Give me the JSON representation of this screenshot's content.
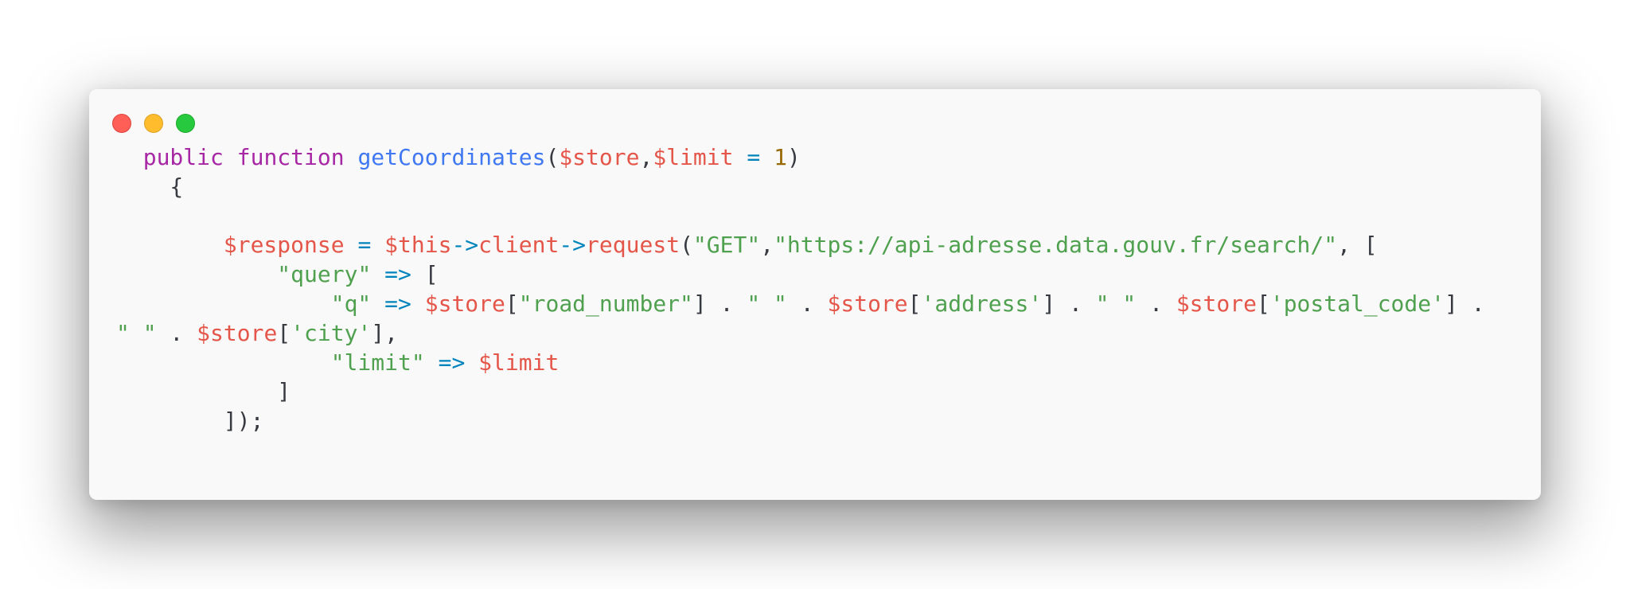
{
  "window": {
    "controls": {
      "close_color": "#ff5f56",
      "minimize_color": "#ffbd2e",
      "maximize_color": "#27c93f"
    }
  },
  "colors": {
    "background": "#f9f9f9",
    "keyword": "#a626a4",
    "function": "#4078f2",
    "variable": "#e45649",
    "operator": "#0184bc",
    "number": "#986801",
    "string": "#50a14f",
    "plain": "#383a42"
  },
  "code": {
    "lines": [
      [
        {
          "t": "  ",
          "c": "pl"
        },
        {
          "t": "public",
          "c": "kw"
        },
        {
          "t": " ",
          "c": "pl"
        },
        {
          "t": "function",
          "c": "kw"
        },
        {
          "t": " ",
          "c": "pl"
        },
        {
          "t": "getCoordinates",
          "c": "fn"
        },
        {
          "t": "(",
          "c": "pl"
        },
        {
          "t": "$store",
          "c": "var"
        },
        {
          "t": ",",
          "c": "pl"
        },
        {
          "t": "$limit",
          "c": "var"
        },
        {
          "t": " ",
          "c": "pl"
        },
        {
          "t": "=",
          "c": "op"
        },
        {
          "t": " ",
          "c": "pl"
        },
        {
          "t": "1",
          "c": "num"
        },
        {
          "t": ")",
          "c": "pl"
        }
      ],
      [
        {
          "t": "    {",
          "c": "pl"
        }
      ],
      [],
      [
        {
          "t": "        ",
          "c": "pl"
        },
        {
          "t": "$response",
          "c": "var"
        },
        {
          "t": " ",
          "c": "pl"
        },
        {
          "t": "=",
          "c": "op"
        },
        {
          "t": " ",
          "c": "pl"
        },
        {
          "t": "$this",
          "c": "var"
        },
        {
          "t": "->",
          "c": "op"
        },
        {
          "t": "client",
          "c": "prop"
        },
        {
          "t": "->",
          "c": "op"
        },
        {
          "t": "request",
          "c": "prop"
        },
        {
          "t": "(",
          "c": "pl"
        },
        {
          "t": "\"GET\"",
          "c": "str"
        },
        {
          "t": ",",
          "c": "pl"
        },
        {
          "t": "\"https://api-adresse.data.gouv.fr/search/\"",
          "c": "str"
        },
        {
          "t": ", [",
          "c": "pl"
        }
      ],
      [
        {
          "t": "            ",
          "c": "pl"
        },
        {
          "t": "\"query\"",
          "c": "str"
        },
        {
          "t": " ",
          "c": "pl"
        },
        {
          "t": "=>",
          "c": "op"
        },
        {
          "t": " [",
          "c": "pl"
        }
      ],
      [
        {
          "t": "                ",
          "c": "pl"
        },
        {
          "t": "\"q\"",
          "c": "str"
        },
        {
          "t": " ",
          "c": "pl"
        },
        {
          "t": "=>",
          "c": "op"
        },
        {
          "t": " ",
          "c": "pl"
        },
        {
          "t": "$store",
          "c": "var"
        },
        {
          "t": "[",
          "c": "pl"
        },
        {
          "t": "\"road_number\"",
          "c": "str"
        },
        {
          "t": "] . ",
          "c": "pl"
        },
        {
          "t": "\" \"",
          "c": "str"
        },
        {
          "t": " . ",
          "c": "pl"
        },
        {
          "t": "$store",
          "c": "var"
        },
        {
          "t": "[",
          "c": "pl"
        },
        {
          "t": "'address'",
          "c": "str"
        },
        {
          "t": "] . ",
          "c": "pl"
        },
        {
          "t": "\" \"",
          "c": "str"
        },
        {
          "t": " . ",
          "c": "pl"
        },
        {
          "t": "$store",
          "c": "var"
        },
        {
          "t": "[",
          "c": "pl"
        },
        {
          "t": "'postal_code'",
          "c": "str"
        },
        {
          "t": "] .",
          "c": "pl"
        }
      ],
      [
        {
          "t": "\" \"",
          "c": "str"
        },
        {
          "t": " . ",
          "c": "pl"
        },
        {
          "t": "$store",
          "c": "var"
        },
        {
          "t": "[",
          "c": "pl"
        },
        {
          "t": "'city'",
          "c": "str"
        },
        {
          "t": "],",
          "c": "pl"
        }
      ],
      [
        {
          "t": "                ",
          "c": "pl"
        },
        {
          "t": "\"limit\"",
          "c": "str"
        },
        {
          "t": " ",
          "c": "pl"
        },
        {
          "t": "=>",
          "c": "op"
        },
        {
          "t": " ",
          "c": "pl"
        },
        {
          "t": "$limit",
          "c": "var"
        }
      ],
      [
        {
          "t": "            ]",
          "c": "pl"
        }
      ],
      [
        {
          "t": "        ]);",
          "c": "pl"
        }
      ]
    ]
  }
}
